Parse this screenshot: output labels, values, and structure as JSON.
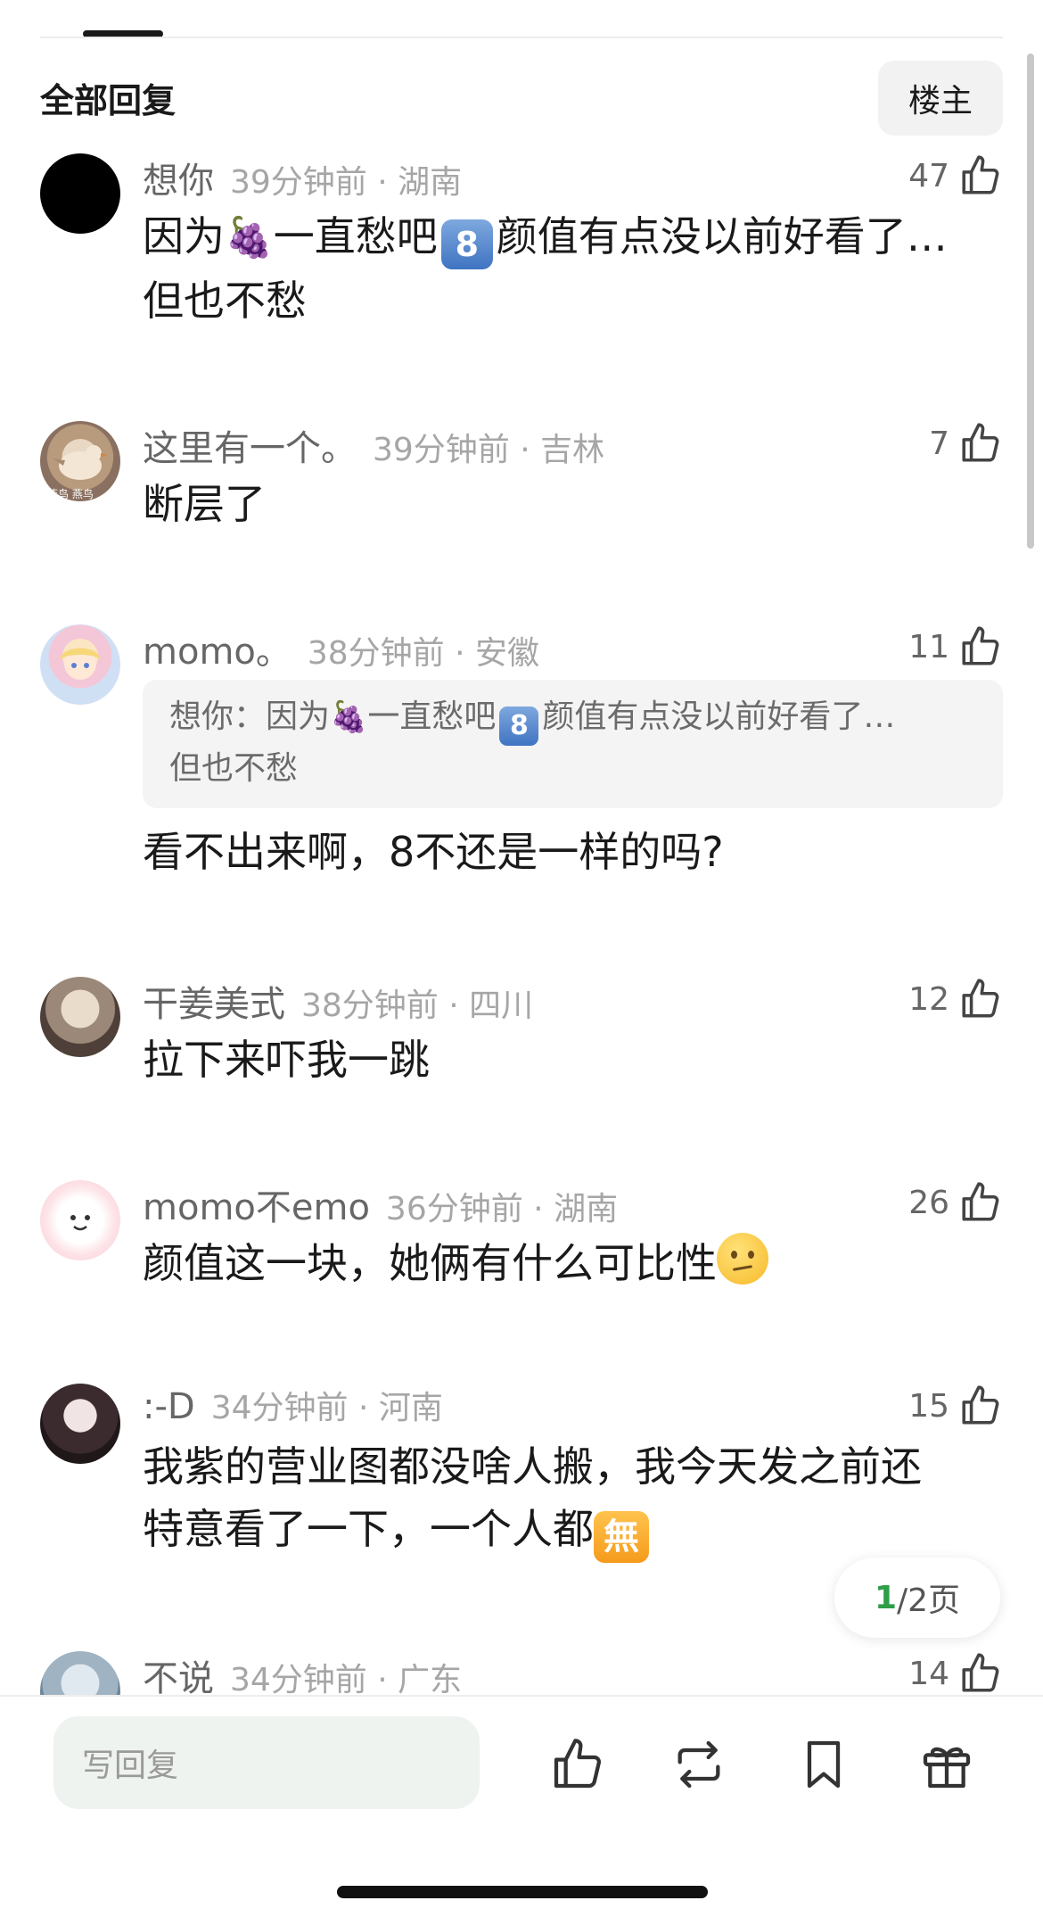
{
  "header": {
    "section_title": "全部回复",
    "filter_label": "楼主"
  },
  "comments": [
    {
      "user": "想你",
      "time": "39分钟前",
      "location": "湖南",
      "likes": "47",
      "text_a": "因为",
      "text_b": "一直愁吧",
      "badge": "8",
      "text_c": "颜值有点没以前好看了…",
      "text_d": "但也不愁"
    },
    {
      "user": "这里有一个。",
      "time": "39分钟前",
      "location": "吉林",
      "likes": "7",
      "text": "断层了",
      "avatar_text": "燕鸟 燕鸟"
    },
    {
      "user": "momo。",
      "time": "38分钟前",
      "location": "安徽",
      "likes": "11",
      "quote_a": "想你：因为",
      "quote_b": "一直愁吧",
      "quote_badge": "8",
      "quote_c": "颜值有点没以前好看了…",
      "quote_d": "但也不愁",
      "text": "看不出来啊，8不还是一样的吗?"
    },
    {
      "user": "干姜美式",
      "time": "38分钟前",
      "location": "四川",
      "likes": "12",
      "text": "拉下来吓我一跳"
    },
    {
      "user": "momo不emo",
      "time": "36分钟前",
      "location": "湖南",
      "likes": "26",
      "text": "颜值这一块，她俩有什么可比性"
    },
    {
      "user": ":-D",
      "time": "34分钟前",
      "location": "河南",
      "likes": "15",
      "text_a": "我紫的营业图都没啥人搬，我今天发之前还",
      "text_b": "特意看了一下，一个人都",
      "badge": "無"
    },
    {
      "user": "不说",
      "time": "34分钟前",
      "location": "广东",
      "likes": "14"
    }
  ],
  "pagination": {
    "current": "1",
    "rest": "/2页"
  },
  "bottom_bar": {
    "reply_placeholder": "写回复"
  },
  "icons": [
    "like-icon",
    "repost-icon",
    "bookmark-icon",
    "gift-icon",
    "grapes-icon",
    "confused-face-icon"
  ]
}
